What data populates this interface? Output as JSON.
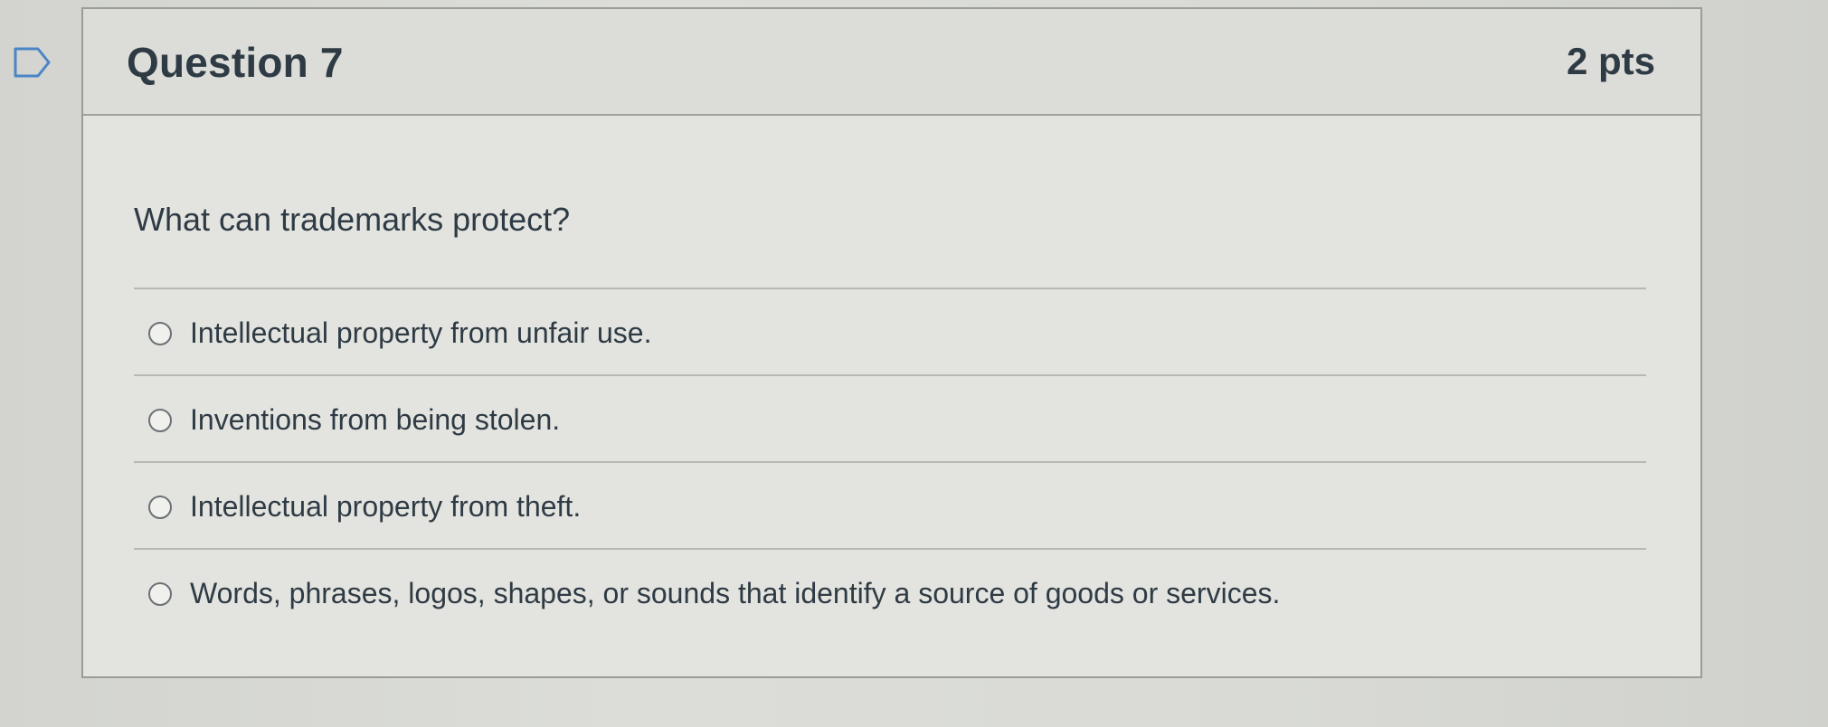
{
  "question": {
    "title": "Question 7",
    "points": "2 pts",
    "prompt": "What can trademarks protect?",
    "flag_icon": "flag-outline-icon",
    "answers": [
      {
        "label": "Intellectual property from unfair use.",
        "selected": false
      },
      {
        "label": "Inventions from being stolen.",
        "selected": false
      },
      {
        "label": "Intellectual property from theft.",
        "selected": false
      },
      {
        "label": "Words, phrases, logos, shapes, or sounds that identify a source of goods or services.",
        "selected": false
      }
    ]
  },
  "colors": {
    "text": "#2f3b44",
    "border": "#9a9c98",
    "flag": "#4a86c5"
  }
}
